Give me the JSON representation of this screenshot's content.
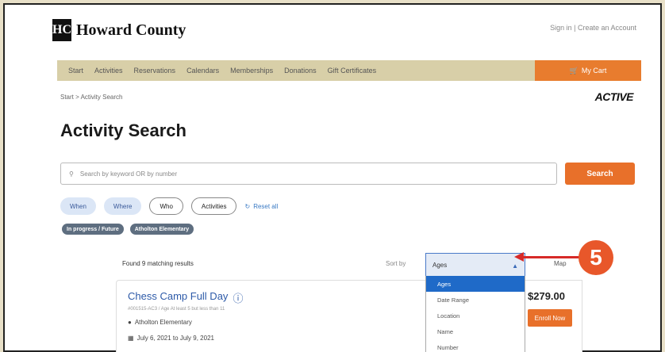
{
  "header": {
    "logo_mark": "HC",
    "logo_text": "Howard County",
    "account_links": "Sign in | Create an Account"
  },
  "nav": {
    "items": [
      "Start",
      "Activities",
      "Reservations",
      "Calendars",
      "Memberships",
      "Donations",
      "Gift Certificates"
    ],
    "cart_label": "My Cart"
  },
  "breadcrumb": "Start > Activity Search",
  "active_logo": "ACTIVE",
  "page_title": "Activity Search",
  "search": {
    "placeholder": "Search by keyword OR by number",
    "button_label": "Search"
  },
  "filters": {
    "pills": [
      "When",
      "Where",
      "Who",
      "Activities"
    ],
    "reset_label": "Reset all"
  },
  "tags": [
    "In progress / Future",
    "Atholton Elementary"
  ],
  "results": {
    "count_label": "Found 9 matching results",
    "sort_label": "Sort by",
    "sort_value": "Ages",
    "partial_link": "Map"
  },
  "card": {
    "title": "Chess Camp Full Day",
    "meta": "#001515-AC3 / Age At least 5 but less than 11",
    "location": "Atholton Elementary",
    "date": "July 6, 2021 to July 9, 2021",
    "price": "$279.00",
    "enroll_label": "Enroll Now"
  },
  "sort_options": [
    "Ages",
    "Date Range",
    "Location",
    "Name",
    "Number"
  ],
  "annotation": {
    "step_number": "5"
  },
  "colors": {
    "accent": "#e8702a",
    "nav_bg": "#d8cfa8",
    "link": "#2d5aa8",
    "annotation": "#d72a28"
  }
}
